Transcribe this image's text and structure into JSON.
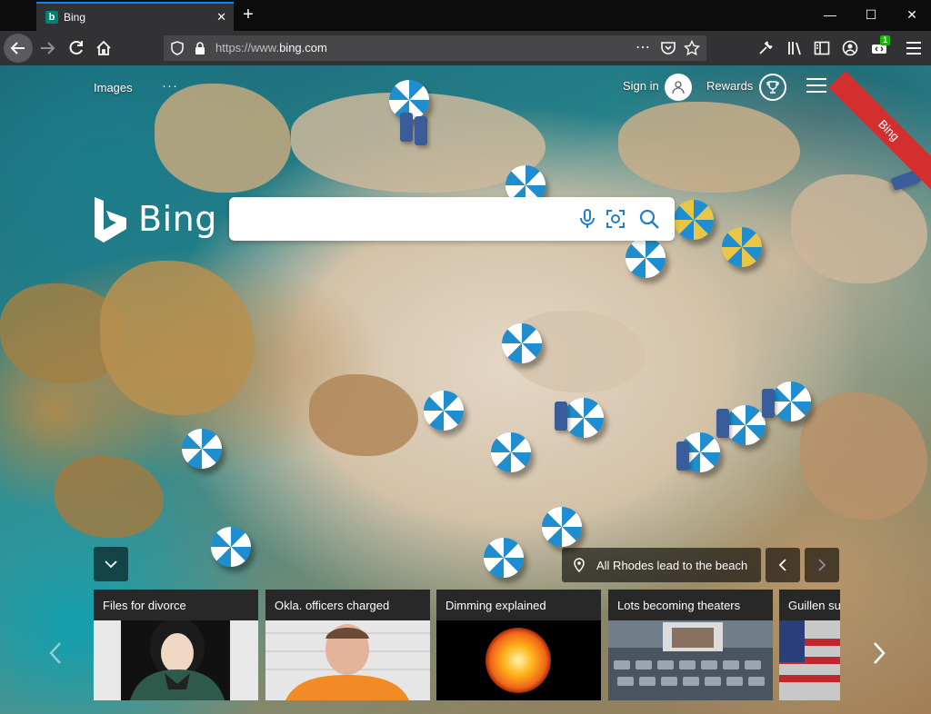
{
  "browser": {
    "tab_title": "Bing",
    "tab_favicon": "b",
    "url_scheme": "https://www.",
    "url_host": "bing.com",
    "addon_badge": "1"
  },
  "bing": {
    "nav_images": "Images",
    "nav_more": "···",
    "sign_in": "Sign in",
    "rewards": "Rewards",
    "ribbon": "Bing",
    "logo_text": "Bing",
    "image_title": "All Rhodes lead to the beach",
    "cards": [
      {
        "title": "Files for divorce"
      },
      {
        "title": "Okla. officers charged"
      },
      {
        "title": "Dimming explained"
      },
      {
        "title": "Lots becoming theaters"
      },
      {
        "title": "Guillen sus"
      }
    ]
  },
  "colors": {
    "chrome_dark": "#0c0c0d",
    "chrome_toolbar": "#323234",
    "accent_tab": "#0a84ff",
    "bing_teal": "#008373",
    "umbrella_blue": "#1f8ed0",
    "ribbon_red": "#d32f2f"
  }
}
